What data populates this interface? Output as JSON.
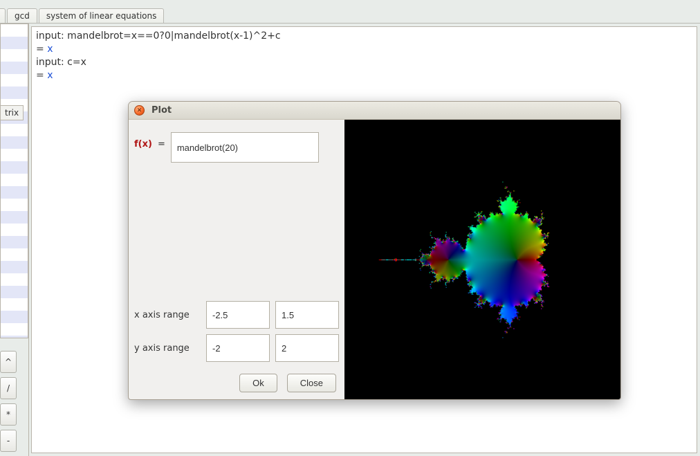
{
  "tabs": {
    "cut": "1",
    "items": [
      "gcd",
      "system of linear equations"
    ]
  },
  "side": {
    "label_cut": "trix",
    "buttons": [
      "^",
      "/",
      "*",
      "-"
    ]
  },
  "worksheet": {
    "lines": [
      "input: mandelbrot=x==0?0|mandelbrot(x-1)^2+c",
      "= ",
      "",
      "input: c=x",
      "= "
    ],
    "result_token": "x"
  },
  "chart_data": {
    "type": "heatmap",
    "description": "Domain-coloring plot of mandelbrot(20) over the complex plane; hue encodes argument, brightness encodes magnitude. Background (divergent region) is black; the interior Mandelbrot-like region is rainbow-colored.",
    "function": "mandelbrot(20)",
    "x_range": [
      -2.5,
      1.5
    ],
    "y_range": [
      -2,
      2
    ],
    "title": "Plot",
    "xlabel": "",
    "ylabel": ""
  },
  "dialog": {
    "title": "Plot",
    "fx_label": "f(x)",
    "eq_symbol": "=",
    "fx_value": "mandelbrot(20)",
    "x_range_label": "x axis range",
    "x_min": "-2.5",
    "x_max": "1.5",
    "y_range_label": "y axis range",
    "y_min": "-2",
    "y_max": "2",
    "ok_label": "Ok",
    "close_label": "Close"
  }
}
